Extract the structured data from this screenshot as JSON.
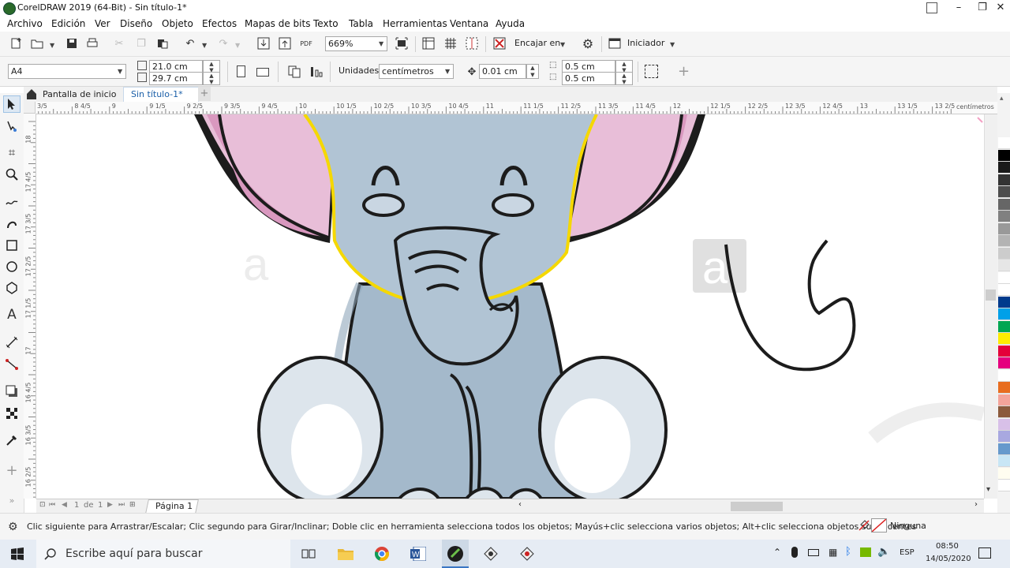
{
  "window": {
    "title": "CorelDRAW 2019 (64-Bit) - Sin título-1*",
    "minimize": "–",
    "maximize": "❐",
    "close": "✕"
  },
  "menu": [
    "Archivo",
    "Edición",
    "Ver",
    "Diseño",
    "Objeto",
    "Efectos",
    "Mapas de bits",
    "Texto",
    "Tabla",
    "Herramientas",
    "Ventana",
    "Ayuda"
  ],
  "toolbar1": {
    "zoom": "669%",
    "fit_label": "Encajar en",
    "launch_label": "Iniciador"
  },
  "toolbar2": {
    "page_size": "A4",
    "width": "21.0 cm",
    "height": "29.7 cm",
    "units_label": "Unidades:",
    "units_value": "centímetros",
    "nudge": "0.01 cm",
    "dup_x": "0.5 cm",
    "dup_y": "0.5 cm"
  },
  "tabs": {
    "home": "Pantalla de inicio",
    "document": "Sin título-1*",
    "add": "+"
  },
  "ruler": {
    "h_labels": [
      "3/5",
      "8 4/5",
      "9",
      "9 1/5",
      "9 2/5",
      "9 3/5",
      "9 4/5",
      "10",
      "10 1/5",
      "10 2/5",
      "10 3/5",
      "10 4/5",
      "11",
      "11 1/5",
      "11 2/5",
      "11 3/5",
      "11 4/5",
      "12",
      "12 1/5",
      "12 2/5",
      "12 3/5",
      "12 4/5",
      "13",
      "13 1/5",
      "13 2/5"
    ],
    "h_unit": "centímetros",
    "v_labels": [
      "18",
      "17 4/5",
      "17 3/5",
      "17 2/5",
      "17 1/5",
      "17",
      "16 4/5",
      "16 3/5",
      "16 2/5"
    ]
  },
  "page_nav": {
    "current": "1",
    "of_label": "de",
    "total": "1",
    "page_tab": "Página 1"
  },
  "status": {
    "hint": "Clic siguiente para Arrastrar/Escalar; Clic segundo para Girar/Inclinar; Doble clic en herramienta selecciona todos los objetos; Mayús+clic selecciona varios objetos; Alt+clic selecciona objetos subyacentes",
    "fill_label": "Ninguna"
  },
  "taskbar": {
    "search_placeholder": "Escribe aquí para buscar",
    "lang": "ESP",
    "time": "08:50",
    "date": "14/05/2020"
  },
  "canvas_watermark": "a",
  "colors": {
    "ear_pink": "#e8bed8",
    "ear_dark_pink": "#d998bf",
    "head_blue": "#b1c4d4",
    "body_blue": "#a4b9cb",
    "foot_light": "#dde5ec",
    "selection_yellow": "#f5d800",
    "outline": "#1c1c1c"
  },
  "palette": [
    "#ffffff",
    "#000000",
    "#1a1a1a",
    "#333333",
    "#4d4d4d",
    "#666666",
    "#808080",
    "#999999",
    "#b3b3b3",
    "#cccccc",
    "#e6e6e6",
    "#ffffff",
    "#ffffff",
    "#003a8c",
    "#00a0e8",
    "#00a651",
    "#ffec00",
    "#e4003a",
    "#e5007e",
    "#ffffff",
    "#e86d1f",
    "#f4a49a",
    "#8b5a3c",
    "#d8c0e8",
    "#a8a8e0",
    "#6699cc",
    "#c8e6f5",
    "#fffdf0",
    "#ffffff"
  ]
}
